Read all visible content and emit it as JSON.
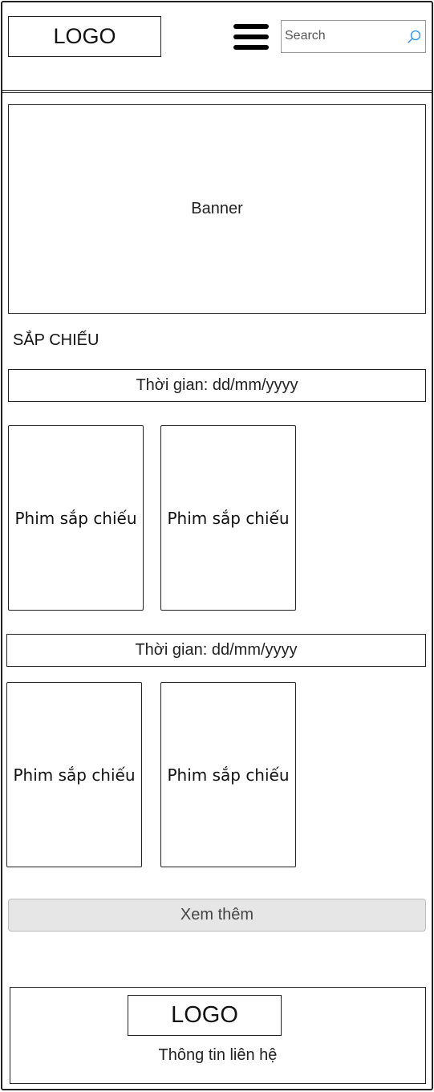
{
  "header": {
    "logo": "LOGO",
    "menu_icon": "hamburger-menu-icon",
    "search": {
      "placeholder": "Search",
      "icon": "search-icon"
    }
  },
  "banner": {
    "label": "Banner"
  },
  "upcoming": {
    "title": "SẮP CHIẾU",
    "groups": [
      {
        "date_label": "Thời gian: dd/mm/yyyy",
        "movies": [
          "Phim sắp chiếu",
          "Phim sắp chiếu"
        ]
      },
      {
        "date_label": "Thời gian: dd/mm/yyyy",
        "movies": [
          "Phim sắp chiếu",
          "Phim sắp chiếu"
        ]
      }
    ],
    "more_label": "Xem thêm"
  },
  "footer": {
    "logo": "LOGO",
    "contact": "Thông tin liên hệ"
  },
  "colors": {
    "border": "#222222",
    "button_bg": "#e6e6e6",
    "search_icon": "#1e90ff"
  }
}
